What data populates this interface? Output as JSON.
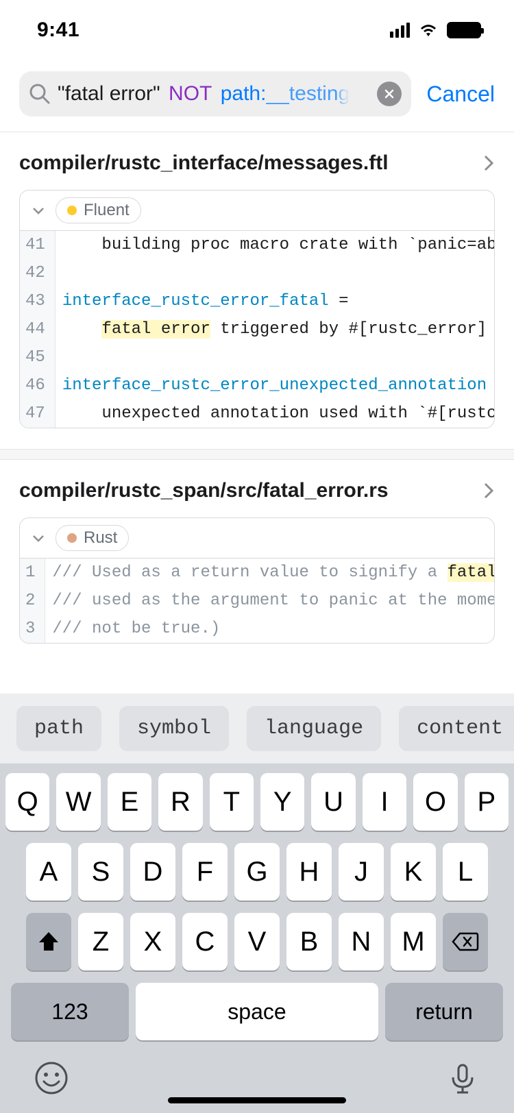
{
  "status": {
    "time": "9:41"
  },
  "search": {
    "query_literal": "\"fatal error\"",
    "query_op": "NOT",
    "query_key": "path:",
    "query_val": "__testin",
    "query_fade": "g",
    "cancel": "Cancel"
  },
  "suggestions": [
    "path",
    "symbol",
    "language",
    "content"
  ],
  "results": [
    {
      "path": "compiler/rustc_interface/messages.ftl",
      "language": {
        "name": "Fluent",
        "color": "#ffcb2b"
      },
      "lines": [
        {
          "num": "41",
          "parts": [
            {
              "t": "plain",
              "v": "    building proc macro crate with `panic=abort"
            }
          ]
        },
        {
          "num": "42",
          "parts": []
        },
        {
          "num": "43",
          "parts": [
            {
              "t": "id",
              "v": "interface_rustc_error_fatal"
            },
            {
              "t": "plain",
              "v": " ="
            }
          ]
        },
        {
          "num": "44",
          "parts": [
            {
              "t": "plain",
              "v": "    "
            },
            {
              "t": "match",
              "v": "fatal error"
            },
            {
              "t": "plain",
              "v": " triggered by #[rustc_error]"
            }
          ]
        },
        {
          "num": "45",
          "parts": []
        },
        {
          "num": "46",
          "parts": [
            {
              "t": "id",
              "v": "interface_rustc_error_unexpected_annotation"
            },
            {
              "t": "plain",
              "v": " ="
            }
          ]
        },
        {
          "num": "47",
          "parts": [
            {
              "t": "plain",
              "v": "    unexpected annotation used with `#[rustc_er"
            }
          ]
        }
      ]
    },
    {
      "path": "compiler/rustc_span/src/fatal_error.rs",
      "language": {
        "name": "Rust",
        "color": "#dea584"
      },
      "lines": [
        {
          "num": "1",
          "parts": [
            {
              "t": "comment",
              "v": "/// Used as a return value to signify a "
            },
            {
              "t": "match",
              "v": "fatal e"
            }
          ]
        },
        {
          "num": "2",
          "parts": [
            {
              "t": "comment",
              "v": "/// used as the argument to panic at the moment"
            }
          ]
        },
        {
          "num": "3",
          "parts": [
            {
              "t": "comment",
              "v": "/// not be true.)"
            }
          ]
        }
      ]
    }
  ],
  "keyboard": {
    "row1": [
      "Q",
      "W",
      "E",
      "R",
      "T",
      "Y",
      "U",
      "I",
      "O",
      "P"
    ],
    "row2": [
      "A",
      "S",
      "D",
      "F",
      "G",
      "H",
      "J",
      "K",
      "L"
    ],
    "row3": [
      "Z",
      "X",
      "C",
      "V",
      "B",
      "N",
      "M"
    ],
    "numKey": "123",
    "space": "space",
    "returnKey": "return"
  }
}
